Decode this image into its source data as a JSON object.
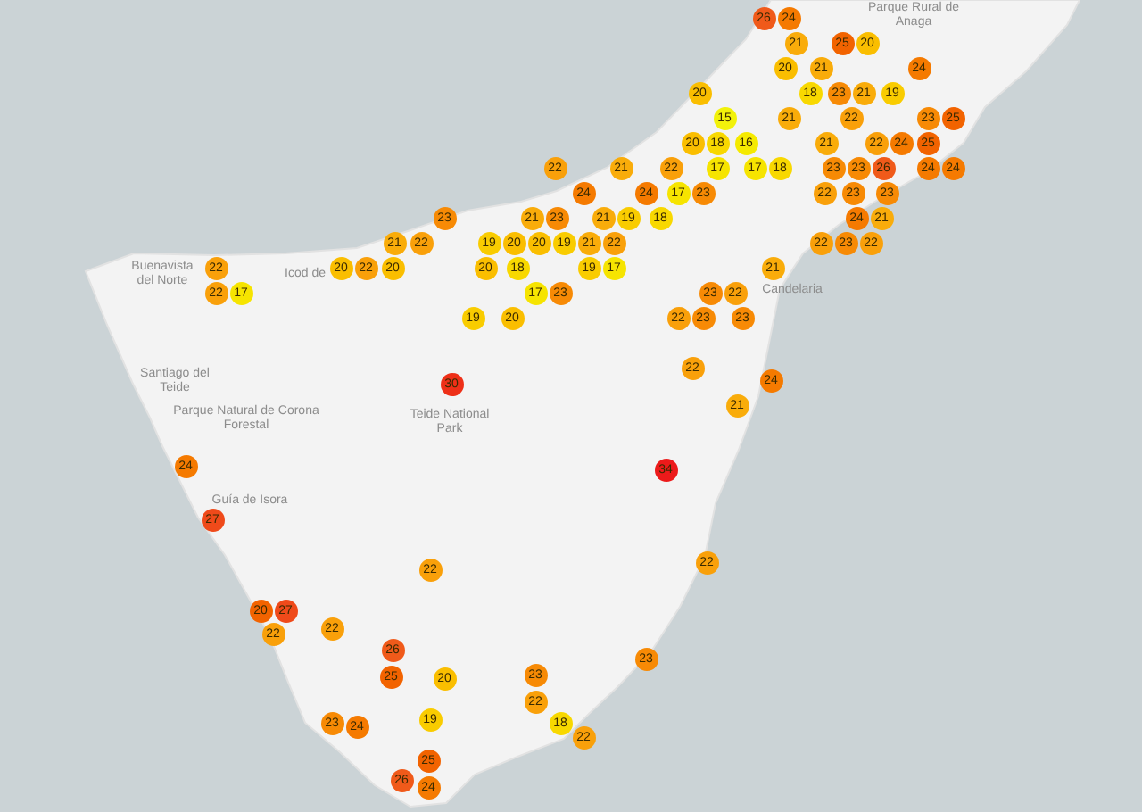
{
  "map": {
    "labels": [
      {
        "text": "Parque Rural de Anaga"
      },
      {
        "text": "Buenavista del Norte"
      },
      {
        "text": "Icod de"
      },
      {
        "text": "Candelaria"
      },
      {
        "text": "Santiago del Teide"
      },
      {
        "text": "Parque Natural de Corona Forestal"
      },
      {
        "text": "Teide National Park"
      },
      {
        "text": "Guía de Isora"
      }
    ],
    "markers": [
      {
        "value": "26",
        "color": "#f05a1a"
      },
      {
        "value": "24",
        "color": "#f57a00"
      },
      {
        "value": "21",
        "color": "#f9ac0a"
      },
      {
        "value": "25",
        "color": "#f26300"
      },
      {
        "value": "20",
        "color": "#fabe00"
      },
      {
        "value": "20",
        "color": "#fabe00"
      },
      {
        "value": "21",
        "color": "#f9ac0a"
      },
      {
        "value": "24",
        "color": "#f57a00"
      },
      {
        "value": "20",
        "color": "#fabe00"
      },
      {
        "value": "18",
        "color": "#f8d800"
      },
      {
        "value": "23",
        "color": "#f78a05"
      },
      {
        "value": "21",
        "color": "#f9ac0a"
      },
      {
        "value": "19",
        "color": "#f9cc00"
      },
      {
        "value": "15",
        "color": "#f2f20a"
      },
      {
        "value": "21",
        "color": "#f9ac0a"
      },
      {
        "value": "22",
        "color": "#f9a00a"
      },
      {
        "value": "23",
        "color": "#f78a05"
      },
      {
        "value": "25",
        "color": "#f26300"
      },
      {
        "value": "20",
        "color": "#fabe00"
      },
      {
        "value": "18",
        "color": "#f8d800"
      },
      {
        "value": "16",
        "color": "#f5ea00"
      },
      {
        "value": "21",
        "color": "#f9ac0a"
      },
      {
        "value": "22",
        "color": "#f9a00a"
      },
      {
        "value": "24",
        "color": "#f57a00"
      },
      {
        "value": "25",
        "color": "#f26300"
      },
      {
        "value": "22",
        "color": "#f9a00a"
      },
      {
        "value": "21",
        "color": "#f9ac0a"
      },
      {
        "value": "22",
        "color": "#f9a00a"
      },
      {
        "value": "17",
        "color": "#f6e400"
      },
      {
        "value": "17",
        "color": "#f6e400"
      },
      {
        "value": "18",
        "color": "#f8d800"
      },
      {
        "value": "23",
        "color": "#f78a05"
      },
      {
        "value": "23",
        "color": "#f78a05"
      },
      {
        "value": "26",
        "color": "#f05a1a"
      },
      {
        "value": "24",
        "color": "#f57a00"
      },
      {
        "value": "24",
        "color": "#f57a00"
      },
      {
        "value": "24",
        "color": "#f57a00"
      },
      {
        "value": "24",
        "color": "#f57a00"
      },
      {
        "value": "17",
        "color": "#f6e400"
      },
      {
        "value": "23",
        "color": "#f78a05"
      },
      {
        "value": "22",
        "color": "#f9a00a"
      },
      {
        "value": "23",
        "color": "#f78a05"
      },
      {
        "value": "23",
        "color": "#f78a05"
      },
      {
        "value": "23",
        "color": "#f78a05"
      },
      {
        "value": "21",
        "color": "#f9ac0a"
      },
      {
        "value": "23",
        "color": "#f78a05"
      },
      {
        "value": "21",
        "color": "#f9ac0a"
      },
      {
        "value": "19",
        "color": "#f9cc00"
      },
      {
        "value": "18",
        "color": "#f8d800"
      },
      {
        "value": "24",
        "color": "#f57a00"
      },
      {
        "value": "21",
        "color": "#f9ac0a"
      },
      {
        "value": "21",
        "color": "#f9ac0a"
      },
      {
        "value": "22",
        "color": "#f9a00a"
      },
      {
        "value": "19",
        "color": "#f9cc00"
      },
      {
        "value": "20",
        "color": "#fabe00"
      },
      {
        "value": "20",
        "color": "#fabe00"
      },
      {
        "value": "19",
        "color": "#f9cc00"
      },
      {
        "value": "21",
        "color": "#f9ac0a"
      },
      {
        "value": "22",
        "color": "#f9a00a"
      },
      {
        "value": "22",
        "color": "#f9a00a"
      },
      {
        "value": "23",
        "color": "#f78a05"
      },
      {
        "value": "22",
        "color": "#f9a00a"
      },
      {
        "value": "22",
        "color": "#f9a00a"
      },
      {
        "value": "20",
        "color": "#fabe00"
      },
      {
        "value": "22",
        "color": "#f9a00a"
      },
      {
        "value": "20",
        "color": "#fabe00"
      },
      {
        "value": "20",
        "color": "#fabe00"
      },
      {
        "value": "18",
        "color": "#f8d800"
      },
      {
        "value": "19",
        "color": "#f9cc00"
      },
      {
        "value": "17",
        "color": "#f6e400"
      },
      {
        "value": "21",
        "color": "#f9ac0a"
      },
      {
        "value": "22",
        "color": "#f9a00a"
      },
      {
        "value": "17",
        "color": "#f6e400"
      },
      {
        "value": "17",
        "color": "#f6e400"
      },
      {
        "value": "23",
        "color": "#f78a05"
      },
      {
        "value": "23",
        "color": "#f78a05"
      },
      {
        "value": "22",
        "color": "#f9a00a"
      },
      {
        "value": "19",
        "color": "#f9cc00"
      },
      {
        "value": "20",
        "color": "#fabe00"
      },
      {
        "value": "22",
        "color": "#f9a00a"
      },
      {
        "value": "23",
        "color": "#f78a05"
      },
      {
        "value": "23",
        "color": "#f78a05"
      },
      {
        "value": "30",
        "color": "#ee3018"
      },
      {
        "value": "22",
        "color": "#f9a00a"
      },
      {
        "value": "24",
        "color": "#f57a00"
      },
      {
        "value": "21",
        "color": "#f9ac0a"
      },
      {
        "value": "24",
        "color": "#f57a00"
      },
      {
        "value": "34",
        "color": "#ec1a1a"
      },
      {
        "value": "27",
        "color": "#ef4a1a"
      },
      {
        "value": "22",
        "color": "#f9a00a"
      },
      {
        "value": "22",
        "color": "#f9a00a"
      },
      {
        "value": "20",
        "color": "#f26300"
      },
      {
        "value": "27",
        "color": "#ef4a1a"
      },
      {
        "value": "22",
        "color": "#f9a00a"
      },
      {
        "value": "22",
        "color": "#f9a00a"
      },
      {
        "value": "26",
        "color": "#f05a1a"
      },
      {
        "value": "23",
        "color": "#f78a05"
      },
      {
        "value": "25",
        "color": "#f26300"
      },
      {
        "value": "20",
        "color": "#fabe00"
      },
      {
        "value": "23",
        "color": "#f78a05"
      },
      {
        "value": "22",
        "color": "#f9a00a"
      },
      {
        "value": "23",
        "color": "#f78a05"
      },
      {
        "value": "24",
        "color": "#f57a00"
      },
      {
        "value": "19",
        "color": "#f9cc00"
      },
      {
        "value": "18",
        "color": "#f8d800"
      },
      {
        "value": "22",
        "color": "#f9a00a"
      },
      {
        "value": "25",
        "color": "#f26300"
      },
      {
        "value": "26",
        "color": "#f05a1a"
      },
      {
        "value": "24",
        "color": "#f57a00"
      }
    ]
  }
}
